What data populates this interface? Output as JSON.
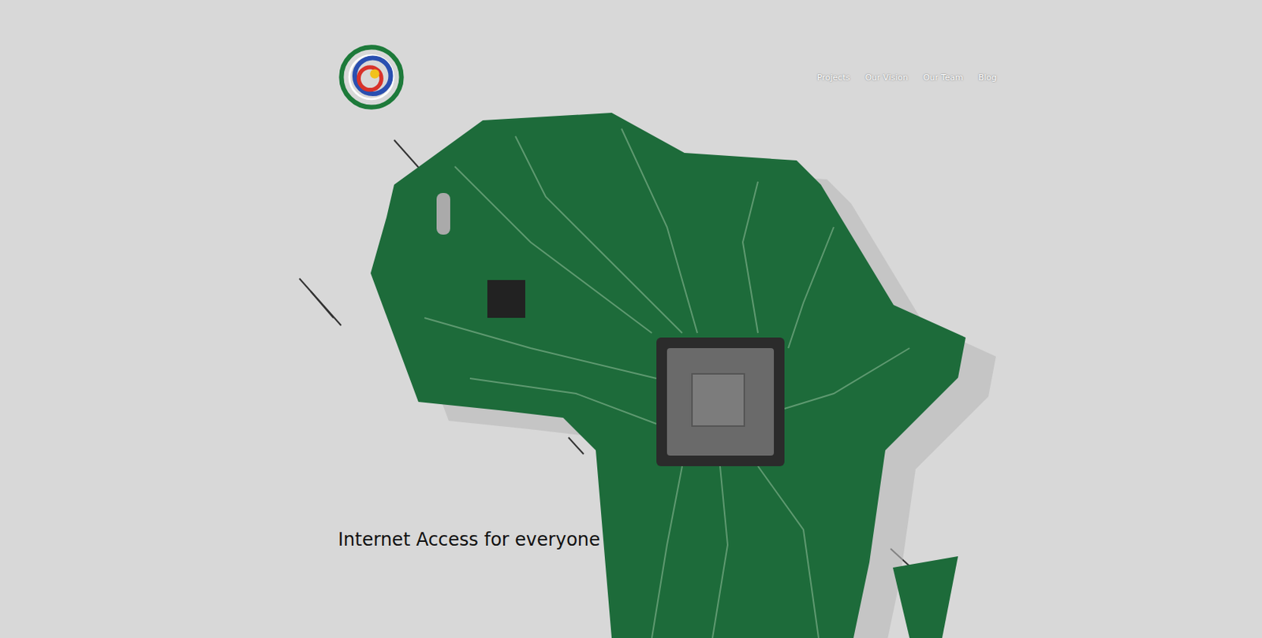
{
  "nav": {
    "items": [
      "Projects",
      "Our Vision",
      "Our Team",
      "Blog"
    ]
  },
  "hero": {
    "headline": "Internet Access for everyone"
  }
}
